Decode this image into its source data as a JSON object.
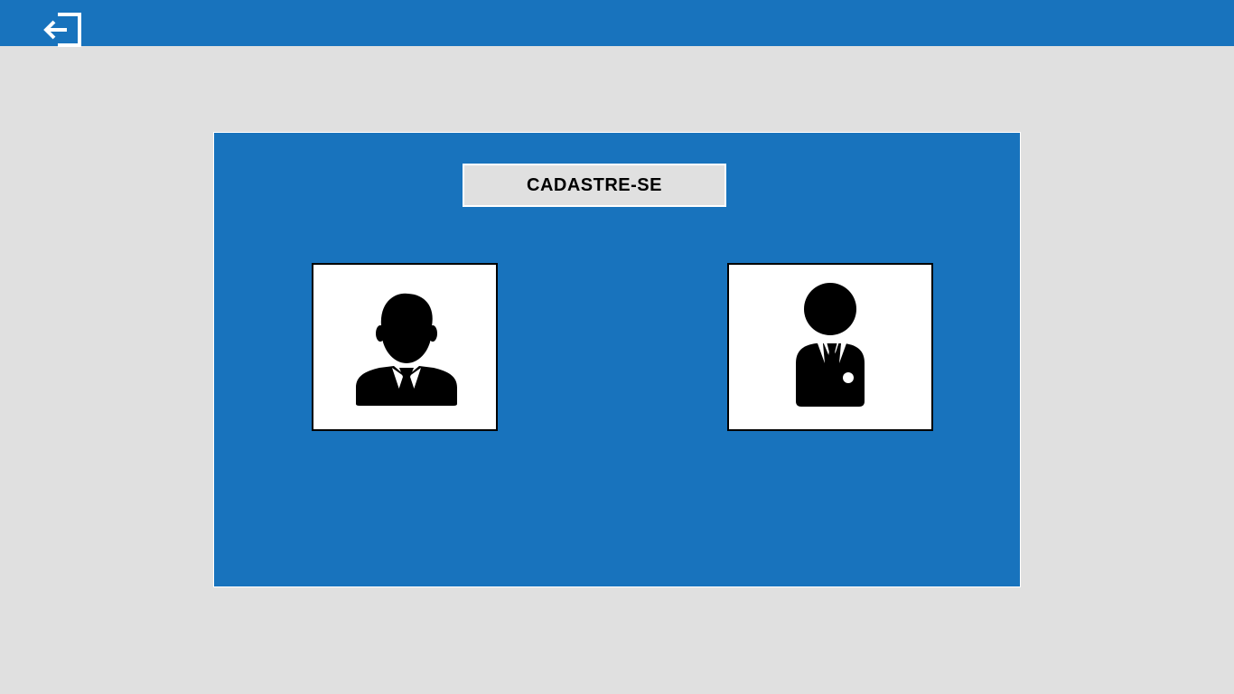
{
  "header": {
    "exit_icon": "exit-icon",
    "background_color": "#1873bd"
  },
  "main": {
    "title": "CADASTRE-SE",
    "panel_color": "#1873bd",
    "options": [
      {
        "icon": "businessman-icon"
      },
      {
        "icon": "employee-badge-icon"
      }
    ]
  }
}
